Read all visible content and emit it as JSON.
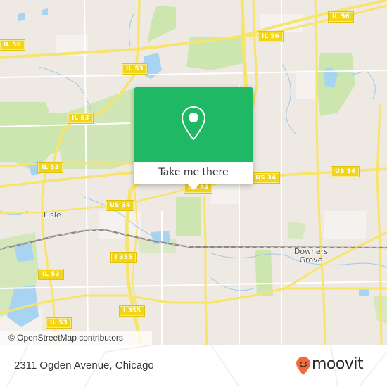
{
  "map": {
    "place_labels": [
      {
        "id": "lisle",
        "text": "Lisle"
      },
      {
        "id": "downers-grove-1",
        "text": "Downers"
      },
      {
        "id": "downers-grove-2",
        "text": "Grove"
      }
    ],
    "shields": [
      {
        "id": "il56-a",
        "text": "IL 56"
      },
      {
        "id": "il56-b",
        "text": "IL 56"
      },
      {
        "id": "il56-c",
        "text": "IL 56"
      },
      {
        "id": "il53-a",
        "text": "IL 53"
      },
      {
        "id": "il53-b",
        "text": "IL 53"
      },
      {
        "id": "il53-c",
        "text": "IL 53"
      },
      {
        "id": "il53-d",
        "text": "IL 53"
      },
      {
        "id": "il53-e",
        "text": "IL 53"
      },
      {
        "id": "us34-a",
        "text": "US 34"
      },
      {
        "id": "us34-b",
        "text": "US 34"
      },
      {
        "id": "us34-c",
        "text": "US 34"
      },
      {
        "id": "us34-d",
        "text": "US 34"
      },
      {
        "id": "i355-a",
        "text": "I 355"
      },
      {
        "id": "i355-b",
        "text": "I 355"
      }
    ],
    "attribution": "© OpenStreetMap contributors",
    "colors": {
      "land": "#efe9e4",
      "park": "#cde6b0",
      "water": "#a8d4f2",
      "road": "#f7e46b",
      "shield": "#f2d419"
    }
  },
  "popup": {
    "icon": "map-pin-icon",
    "button_label": "Take me there",
    "accent_color": "#1fb865"
  },
  "footer": {
    "address": "2311 Ogden Avenue, Chicago",
    "brand": "moovit",
    "brand_color": "#f26a3b"
  }
}
